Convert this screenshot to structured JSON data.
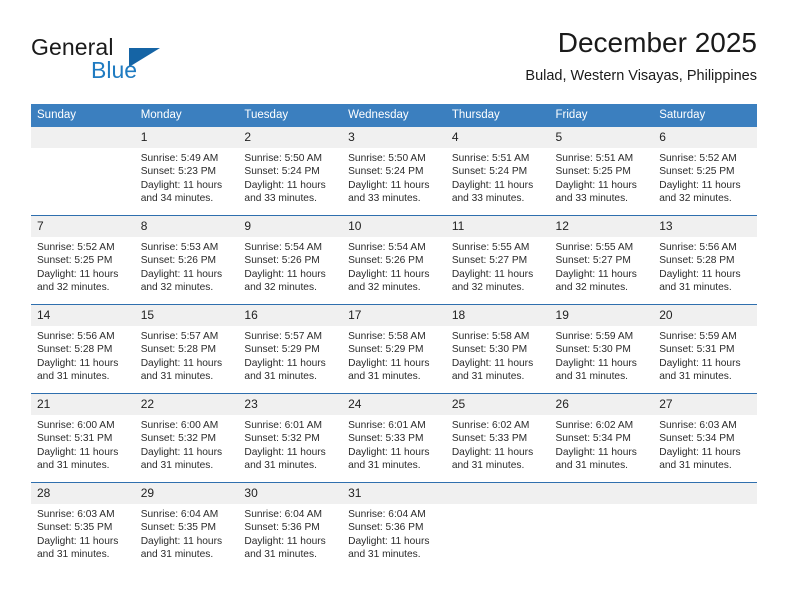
{
  "brand": {
    "name_part1": "General",
    "name_part2": "Blue",
    "flag_icon": "triangle-flag-icon"
  },
  "header": {
    "title": "December 2025",
    "subtitle": "Bulad, Western Visayas, Philippines"
  },
  "calendar": {
    "weekday_headers": [
      "Sunday",
      "Monday",
      "Tuesday",
      "Wednesday",
      "Thursday",
      "Friday",
      "Saturday"
    ],
    "accent_color": "#3b7fbf",
    "border_color": "#2f6fae",
    "daynum_background": "#f0f0f0",
    "weeks": [
      [
        {
          "day": "",
          "sunrise": "",
          "sunset": "",
          "daylight_line1": "",
          "daylight_line2": ""
        },
        {
          "day": "1",
          "sunrise": "Sunrise: 5:49 AM",
          "sunset": "Sunset: 5:23 PM",
          "daylight_line1": "Daylight: 11 hours",
          "daylight_line2": "and 34 minutes."
        },
        {
          "day": "2",
          "sunrise": "Sunrise: 5:50 AM",
          "sunset": "Sunset: 5:24 PM",
          "daylight_line1": "Daylight: 11 hours",
          "daylight_line2": "and 33 minutes."
        },
        {
          "day": "3",
          "sunrise": "Sunrise: 5:50 AM",
          "sunset": "Sunset: 5:24 PM",
          "daylight_line1": "Daylight: 11 hours",
          "daylight_line2": "and 33 minutes."
        },
        {
          "day": "4",
          "sunrise": "Sunrise: 5:51 AM",
          "sunset": "Sunset: 5:24 PM",
          "daylight_line1": "Daylight: 11 hours",
          "daylight_line2": "and 33 minutes."
        },
        {
          "day": "5",
          "sunrise": "Sunrise: 5:51 AM",
          "sunset": "Sunset: 5:25 PM",
          "daylight_line1": "Daylight: 11 hours",
          "daylight_line2": "and 33 minutes."
        },
        {
          "day": "6",
          "sunrise": "Sunrise: 5:52 AM",
          "sunset": "Sunset: 5:25 PM",
          "daylight_line1": "Daylight: 11 hours",
          "daylight_line2": "and 32 minutes."
        }
      ],
      [
        {
          "day": "7",
          "sunrise": "Sunrise: 5:52 AM",
          "sunset": "Sunset: 5:25 PM",
          "daylight_line1": "Daylight: 11 hours",
          "daylight_line2": "and 32 minutes."
        },
        {
          "day": "8",
          "sunrise": "Sunrise: 5:53 AM",
          "sunset": "Sunset: 5:26 PM",
          "daylight_line1": "Daylight: 11 hours",
          "daylight_line2": "and 32 minutes."
        },
        {
          "day": "9",
          "sunrise": "Sunrise: 5:54 AM",
          "sunset": "Sunset: 5:26 PM",
          "daylight_line1": "Daylight: 11 hours",
          "daylight_line2": "and 32 minutes."
        },
        {
          "day": "10",
          "sunrise": "Sunrise: 5:54 AM",
          "sunset": "Sunset: 5:26 PM",
          "daylight_line1": "Daylight: 11 hours",
          "daylight_line2": "and 32 minutes."
        },
        {
          "day": "11",
          "sunrise": "Sunrise: 5:55 AM",
          "sunset": "Sunset: 5:27 PM",
          "daylight_line1": "Daylight: 11 hours",
          "daylight_line2": "and 32 minutes."
        },
        {
          "day": "12",
          "sunrise": "Sunrise: 5:55 AM",
          "sunset": "Sunset: 5:27 PM",
          "daylight_line1": "Daylight: 11 hours",
          "daylight_line2": "and 32 minutes."
        },
        {
          "day": "13",
          "sunrise": "Sunrise: 5:56 AM",
          "sunset": "Sunset: 5:28 PM",
          "daylight_line1": "Daylight: 11 hours",
          "daylight_line2": "and 31 minutes."
        }
      ],
      [
        {
          "day": "14",
          "sunrise": "Sunrise: 5:56 AM",
          "sunset": "Sunset: 5:28 PM",
          "daylight_line1": "Daylight: 11 hours",
          "daylight_line2": "and 31 minutes."
        },
        {
          "day": "15",
          "sunrise": "Sunrise: 5:57 AM",
          "sunset": "Sunset: 5:28 PM",
          "daylight_line1": "Daylight: 11 hours",
          "daylight_line2": "and 31 minutes."
        },
        {
          "day": "16",
          "sunrise": "Sunrise: 5:57 AM",
          "sunset": "Sunset: 5:29 PM",
          "daylight_line1": "Daylight: 11 hours",
          "daylight_line2": "and 31 minutes."
        },
        {
          "day": "17",
          "sunrise": "Sunrise: 5:58 AM",
          "sunset": "Sunset: 5:29 PM",
          "daylight_line1": "Daylight: 11 hours",
          "daylight_line2": "and 31 minutes."
        },
        {
          "day": "18",
          "sunrise": "Sunrise: 5:58 AM",
          "sunset": "Sunset: 5:30 PM",
          "daylight_line1": "Daylight: 11 hours",
          "daylight_line2": "and 31 minutes."
        },
        {
          "day": "19",
          "sunrise": "Sunrise: 5:59 AM",
          "sunset": "Sunset: 5:30 PM",
          "daylight_line1": "Daylight: 11 hours",
          "daylight_line2": "and 31 minutes."
        },
        {
          "day": "20",
          "sunrise": "Sunrise: 5:59 AM",
          "sunset": "Sunset: 5:31 PM",
          "daylight_line1": "Daylight: 11 hours",
          "daylight_line2": "and 31 minutes."
        }
      ],
      [
        {
          "day": "21",
          "sunrise": "Sunrise: 6:00 AM",
          "sunset": "Sunset: 5:31 PM",
          "daylight_line1": "Daylight: 11 hours",
          "daylight_line2": "and 31 minutes."
        },
        {
          "day": "22",
          "sunrise": "Sunrise: 6:00 AM",
          "sunset": "Sunset: 5:32 PM",
          "daylight_line1": "Daylight: 11 hours",
          "daylight_line2": "and 31 minutes."
        },
        {
          "day": "23",
          "sunrise": "Sunrise: 6:01 AM",
          "sunset": "Sunset: 5:32 PM",
          "daylight_line1": "Daylight: 11 hours",
          "daylight_line2": "and 31 minutes."
        },
        {
          "day": "24",
          "sunrise": "Sunrise: 6:01 AM",
          "sunset": "Sunset: 5:33 PM",
          "daylight_line1": "Daylight: 11 hours",
          "daylight_line2": "and 31 minutes."
        },
        {
          "day": "25",
          "sunrise": "Sunrise: 6:02 AM",
          "sunset": "Sunset: 5:33 PM",
          "daylight_line1": "Daylight: 11 hours",
          "daylight_line2": "and 31 minutes."
        },
        {
          "day": "26",
          "sunrise": "Sunrise: 6:02 AM",
          "sunset": "Sunset: 5:34 PM",
          "daylight_line1": "Daylight: 11 hours",
          "daylight_line2": "and 31 minutes."
        },
        {
          "day": "27",
          "sunrise": "Sunrise: 6:03 AM",
          "sunset": "Sunset: 5:34 PM",
          "daylight_line1": "Daylight: 11 hours",
          "daylight_line2": "and 31 minutes."
        }
      ],
      [
        {
          "day": "28",
          "sunrise": "Sunrise: 6:03 AM",
          "sunset": "Sunset: 5:35 PM",
          "daylight_line1": "Daylight: 11 hours",
          "daylight_line2": "and 31 minutes."
        },
        {
          "day": "29",
          "sunrise": "Sunrise: 6:04 AM",
          "sunset": "Sunset: 5:35 PM",
          "daylight_line1": "Daylight: 11 hours",
          "daylight_line2": "and 31 minutes."
        },
        {
          "day": "30",
          "sunrise": "Sunrise: 6:04 AM",
          "sunset": "Sunset: 5:36 PM",
          "daylight_line1": "Daylight: 11 hours",
          "daylight_line2": "and 31 minutes."
        },
        {
          "day": "31",
          "sunrise": "Sunrise: 6:04 AM",
          "sunset": "Sunset: 5:36 PM",
          "daylight_line1": "Daylight: 11 hours",
          "daylight_line2": "and 31 minutes."
        },
        {
          "day": "",
          "sunrise": "",
          "sunset": "",
          "daylight_line1": "",
          "daylight_line2": ""
        },
        {
          "day": "",
          "sunrise": "",
          "sunset": "",
          "daylight_line1": "",
          "daylight_line2": ""
        },
        {
          "day": "",
          "sunrise": "",
          "sunset": "",
          "daylight_line1": "",
          "daylight_line2": ""
        }
      ]
    ]
  }
}
